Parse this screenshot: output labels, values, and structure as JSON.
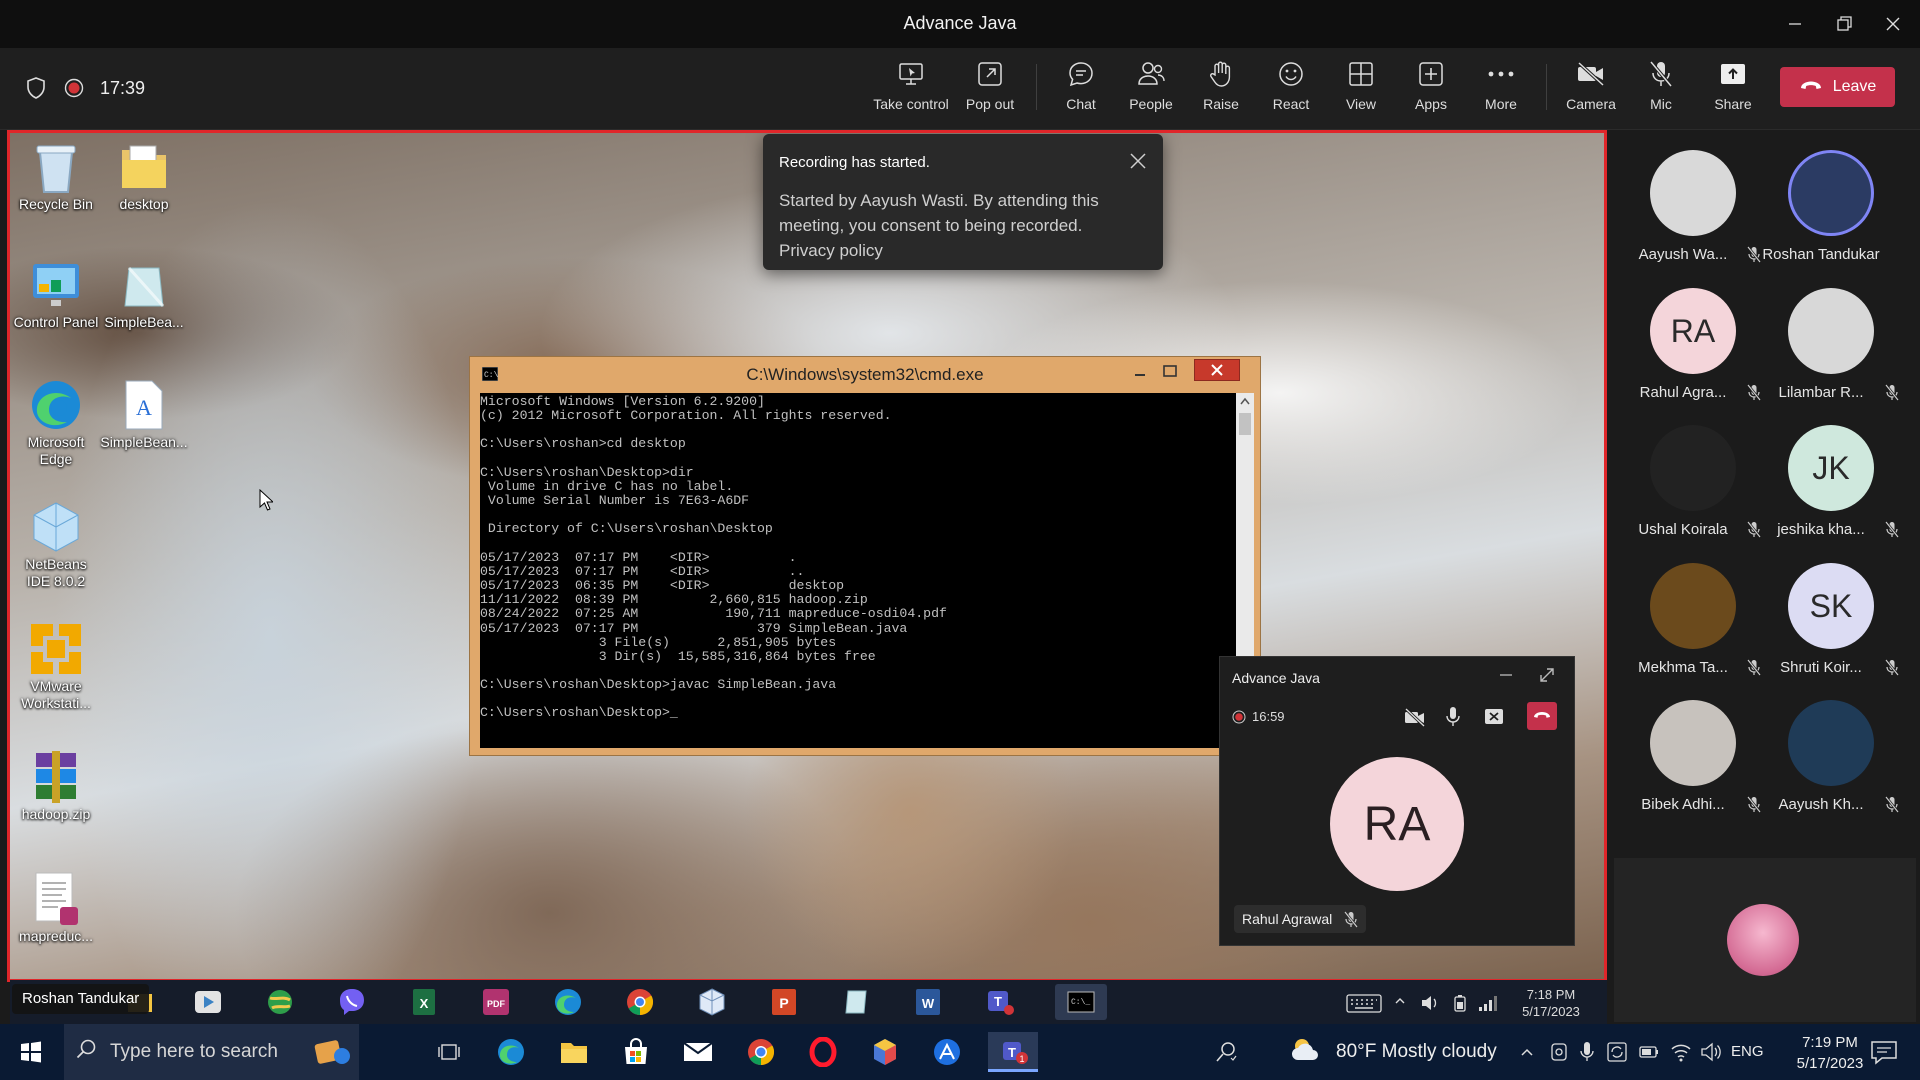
{
  "window": {
    "title": "Advance Java"
  },
  "meeting_bar": {
    "elapsed": "17:39",
    "buttons": [
      {
        "label": "Take control",
        "icon": "take-control-icon"
      },
      {
        "label": "Pop out",
        "icon": "pop-out-icon"
      },
      {
        "label": "Chat",
        "icon": "chat-icon"
      },
      {
        "label": "People",
        "icon": "people-icon"
      },
      {
        "label": "Raise",
        "icon": "raise-hand-icon"
      },
      {
        "label": "React",
        "icon": "react-icon"
      },
      {
        "label": "View",
        "icon": "view-icon"
      },
      {
        "label": "Apps",
        "icon": "apps-icon"
      },
      {
        "label": "More",
        "icon": "more-icon"
      },
      {
        "label": "Camera",
        "icon": "camera-off-icon"
      },
      {
        "label": "Mic",
        "icon": "mic-off-icon"
      },
      {
        "label": "Share",
        "icon": "share-icon"
      }
    ],
    "leave_label": "Leave",
    "leave_color": "#c4314b"
  },
  "toast": {
    "heading": "Recording has started.",
    "body": "Started by Aayush Wasti. By attending this meeting, you consent to being recorded.",
    "link": "Privacy policy"
  },
  "desktop_icons": [
    {
      "label": "Recycle Bin",
      "icon": "recycle-bin-icon"
    },
    {
      "label": "desktop",
      "icon": "folder-icon"
    },
    {
      "label": "Control Panel",
      "icon": "control-panel-icon"
    },
    {
      "label": "SimpleBea...",
      "icon": "file-icon"
    },
    {
      "label": "Microsoft Edge",
      "icon": "edge-icon"
    },
    {
      "label": "SimpleBean...",
      "icon": "text-file-icon"
    },
    {
      "label": "NetBeans IDE 8.0.2",
      "icon": "netbeans-icon"
    },
    {
      "label": "VMware Workstati...",
      "icon": "vmware-icon"
    },
    {
      "label": "hadoop.zip",
      "icon": "winrar-icon"
    },
    {
      "label": "mapreduc...",
      "icon": "pdf-file-icon"
    }
  ],
  "cmd": {
    "title": "C:\\Windows\\system32\\cmd.exe",
    "lines": [
      "Microsoft Windows [Version 6.2.9200]",
      "(c) 2012 Microsoft Corporation. All rights reserved.",
      "",
      "C:\\Users\\roshan>cd desktop",
      "",
      "C:\\Users\\roshan\\Desktop>dir",
      " Volume in drive C has no label.",
      " Volume Serial Number is 7E63-A6DF",
      "",
      " Directory of C:\\Users\\roshan\\Desktop",
      "",
      "05/17/2023  07:17 PM    <DIR>          .",
      "05/17/2023  07:17 PM    <DIR>          ..",
      "05/17/2023  06:35 PM    <DIR>          desktop",
      "11/11/2022  08:39 PM         2,660,815 hadoop.zip",
      "08/24/2022  07:25 AM           190,711 mapreduce-osdi04.pdf",
      "05/17/2023  07:17 PM               379 SimpleBean.java",
      "               3 File(s)      2,851,905 bytes",
      "               3 Dir(s)  15,585,316,864 bytes free",
      "",
      "C:\\Users\\roshan\\Desktop>javac SimpleBean.java",
      "",
      "C:\\Users\\roshan\\Desktop>_"
    ]
  },
  "shared_taskbar": {
    "presenter": "Roshan Tandukar",
    "icons": [
      "file-explorer-icon",
      "media-player-icon",
      "globe-icon",
      "viber-icon",
      "excel-icon",
      "pdf-icon",
      "edge-icon",
      "chrome-icon",
      "virtualbox-icon",
      "powerpoint-icon",
      "notepad-icon",
      "word-icon",
      "teams-icon",
      "cmd-icon"
    ],
    "time": "7:18 PM",
    "date": "5/17/2023"
  },
  "mini_window": {
    "title": "Advance Java",
    "elapsed": "16:59",
    "initials": "RA",
    "name": "Rahul Agrawal"
  },
  "participants": [
    {
      "name": "Aayush Wa...",
      "initials": "",
      "avatar_bg": "#d9d9d9",
      "muted": true
    },
    {
      "name": "Roshan Tandukar",
      "initials": "",
      "avatar_bg": "#2b3b63",
      "muted": false
    },
    {
      "name": "Rahul Agra...",
      "initials": "RA",
      "avatar_bg": "#f4d5da",
      "muted": true
    },
    {
      "name": "Lilambar R...",
      "initials": "",
      "avatar_bg": "#d8d8d8",
      "muted": true
    },
    {
      "name": "Ushal Koirala",
      "initials": "",
      "avatar_bg": "#222222",
      "muted": true
    },
    {
      "name": "jeshika kha...",
      "initials": "JK",
      "avatar_bg": "#cfe8dd",
      "muted": true
    },
    {
      "name": "Mekhma Ta...",
      "initials": "",
      "avatar_bg": "#6b4a1c",
      "muted": true
    },
    {
      "name": "Shruti Koir...",
      "initials": "SK",
      "avatar_bg": "#dcdcf3",
      "muted": true
    },
    {
      "name": "Bibek Adhi...",
      "initials": "",
      "avatar_bg": "#c7c2bd",
      "muted": true
    },
    {
      "name": "Aayush Kh...",
      "initials": "",
      "avatar_bg": "#1f3b57",
      "muted": true
    }
  ],
  "os_taskbar": {
    "search_placeholder": "Type here to search",
    "weather": "80°F  Mostly cloudy",
    "lang": "ENG",
    "time": "7:19 PM",
    "date": "5/17/2023",
    "notification_count": "1"
  }
}
